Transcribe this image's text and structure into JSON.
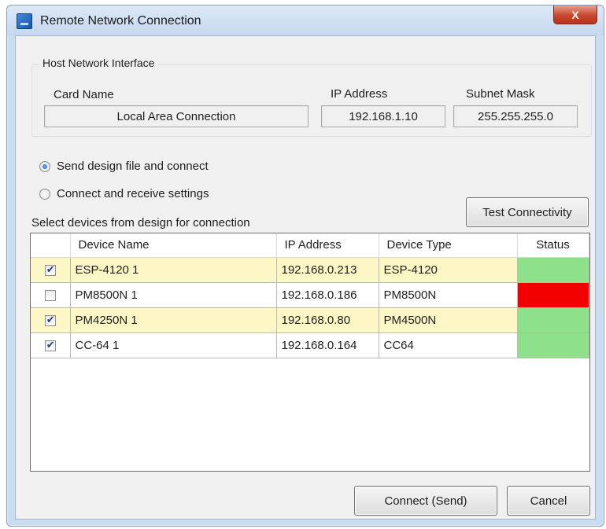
{
  "window": {
    "title": "Remote Network Connection",
    "close_glyph": "X"
  },
  "host": {
    "group_label": "Host Network Interface",
    "card_name_label": "Card Name",
    "ip_label": "IP Address",
    "subnet_label": "Subnet Mask",
    "card_name": "Local Area Connection",
    "ip": "192.168.1.10",
    "subnet": "255.255.255.0"
  },
  "mode": {
    "send_label": "Send design file and connect",
    "receive_label": "Connect and receive settings",
    "selected": "send"
  },
  "devices": {
    "section_label": "Select devices from design for connection",
    "test_button": "Test Connectivity",
    "columns": [
      "",
      "Device Name",
      "IP Address",
      "Device Type",
      "Status"
    ],
    "rows": [
      {
        "checked": true,
        "name": "ESP-4120 1",
        "ip": "192.168.0.213",
        "type": "ESP-4120",
        "status_color": "#8fe08a",
        "highlight": true
      },
      {
        "checked": false,
        "name": "PM8500N 1",
        "ip": "192.168.0.186",
        "type": "PM8500N",
        "status_color": "#f20000",
        "highlight": false
      },
      {
        "checked": true,
        "name": "PM4250N 1",
        "ip": "192.168.0.80",
        "type": "PM4500N",
        "status_color": "#8fe08a",
        "highlight": true
      },
      {
        "checked": true,
        "name": "CC-64 1",
        "ip": "192.168.0.164",
        "type": "CC64",
        "status_color": "#8fe08a",
        "highlight": false
      }
    ]
  },
  "footer": {
    "connect_button": "Connect (Send)",
    "cancel_button": "Cancel"
  }
}
